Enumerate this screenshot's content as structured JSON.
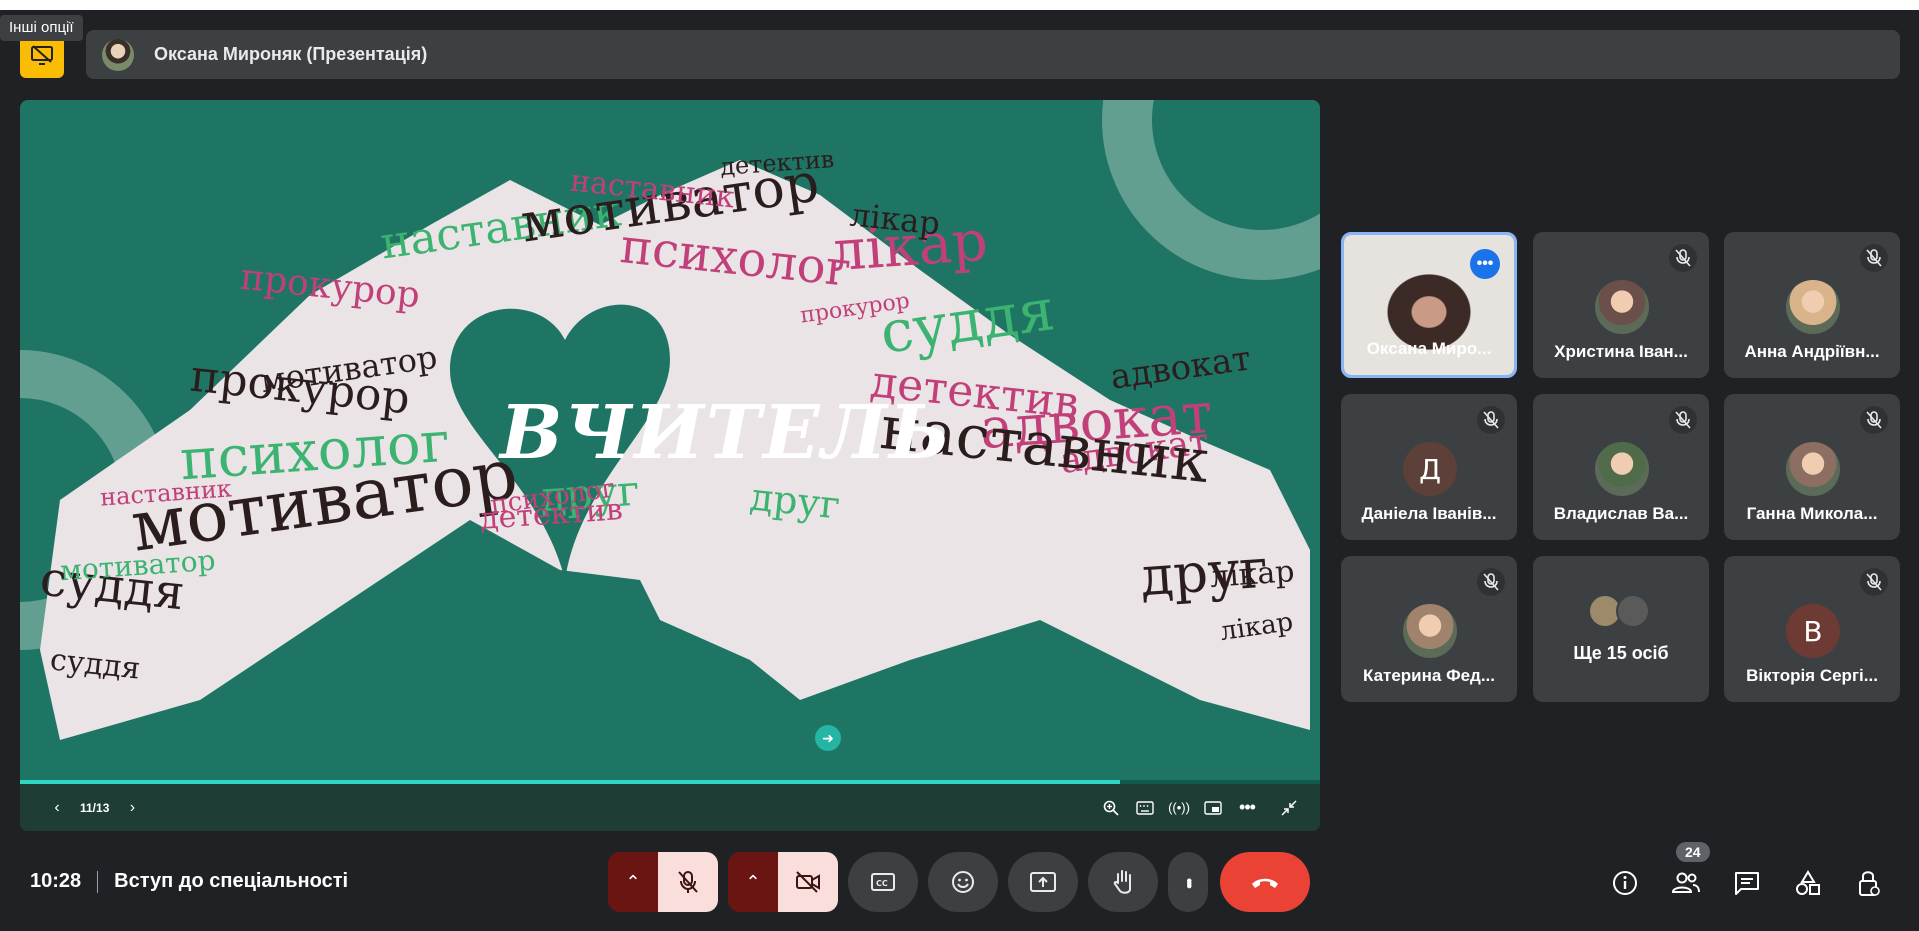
{
  "tooltip": "Інші опції",
  "presenter": {
    "name": "Оксана Мироняк (Презентація)"
  },
  "slide": {
    "title": "ВЧИТЕЛЬ",
    "page": "11/13",
    "progress_fraction": 0.846
  },
  "word_cloud": [
    "мотиватор",
    "психолог",
    "лікар",
    "наставник",
    "прокурор",
    "адвокат",
    "суддя",
    "детектив",
    "друг",
    "мотиватор",
    "прокурор",
    "психолог",
    "мотиватор",
    "суддя",
    "детектив",
    "адвокат",
    "наставник",
    "друг",
    "лікар",
    "суддя",
    "мотиватор",
    "психолог",
    "наставник",
    "детектив",
    "прокурор",
    "друг",
    "лікар",
    "адвокат",
    "лікар",
    "наставник"
  ],
  "participants": [
    {
      "name": "Оксана Миро...",
      "muted": false,
      "active": true,
      "avatar": "video"
    },
    {
      "name": "Христина Іван...",
      "muted": true,
      "avatar": "photo",
      "avatar_color": "#6b4f4a"
    },
    {
      "name": "Анна Андріївн...",
      "muted": true,
      "avatar": "photo",
      "avatar_color": "#d9b48a"
    },
    {
      "name": "Даніела Іванів...",
      "muted": true,
      "avatar": "letter",
      "letter": "Д",
      "avatar_color": "#5d4037"
    },
    {
      "name": "Владислав Ва...",
      "muted": true,
      "avatar": "photo",
      "avatar_color": "#4f6b4a"
    },
    {
      "name": "Ганна Микола...",
      "muted": true,
      "avatar": "photo",
      "avatar_color": "#8d6e63"
    },
    {
      "name": "Катерина Фед...",
      "muted": true,
      "avatar": "photo",
      "avatar_color": "#a0826d"
    },
    {
      "name": "Ще 15 осіб",
      "muted": false,
      "avatar": "group"
    },
    {
      "name": "Вікторія Сергі...",
      "muted": true,
      "avatar": "letter",
      "letter": "В",
      "avatar_color": "#6d3b33"
    }
  ],
  "bottom": {
    "time": "10:28",
    "meeting_title": "Вступ до спеціальності",
    "people_count": "24"
  },
  "colors": {
    "slide_bg": "#1f7564",
    "accent_yellow": "#fbbc04",
    "end_call": "#ea4335",
    "active_border": "#8ab4f8",
    "word_pink": "#c2407a",
    "word_green": "#3cb371",
    "word_dark": "#2b1d1d"
  },
  "icons": {
    "present": "stop-presenting-icon",
    "mic": "mic-off-icon",
    "cam": "camera-off-icon",
    "captions": "captions-icon",
    "emoji": "emoji-icon",
    "present_now": "present-screen-icon",
    "raise_hand": "raise-hand-icon",
    "more": "more-vert-icon",
    "end": "call-end-icon",
    "info": "info-icon",
    "people": "people-icon",
    "chat": "chat-icon",
    "activities": "activities-icon",
    "host": "host-controls-icon"
  }
}
